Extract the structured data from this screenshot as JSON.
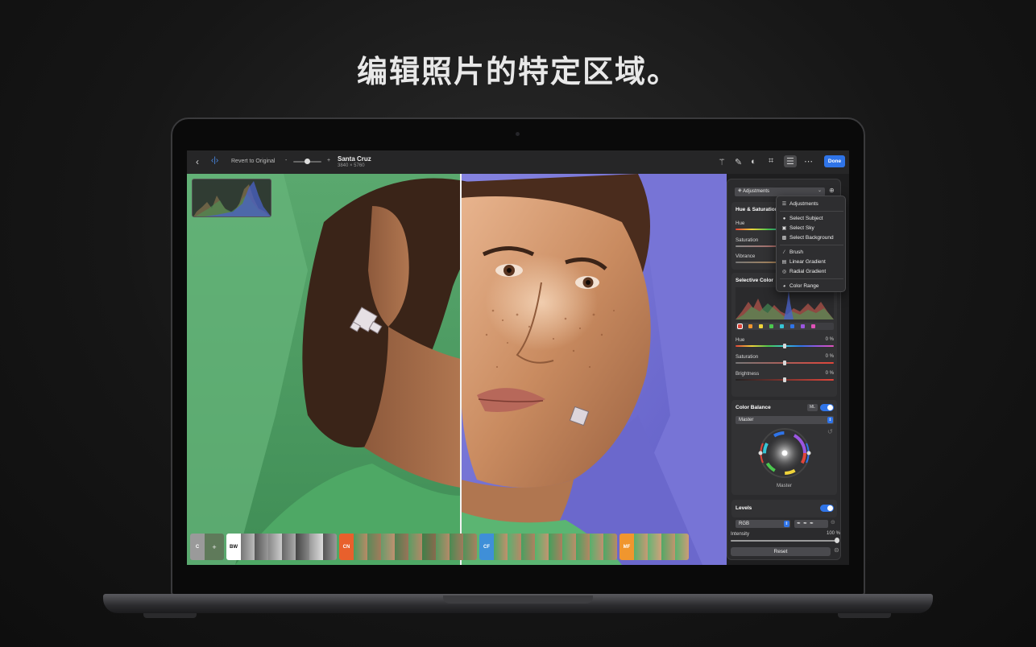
{
  "headline": "编辑照片的特定区域。",
  "toolbar": {
    "back_icon": "chevron-left-icon",
    "compare_icon": "compare-split-icon",
    "revert_label": "Revert to Original",
    "zoom_minus": "-",
    "zoom_plus": "+",
    "doc_title": "Santa Cruz",
    "doc_size": "3840 × 5760",
    "tools": [
      "magic-wand-icon",
      "eraser-icon",
      "mask-icon",
      "crop-icon",
      "adjustments-icon",
      "more-icon"
    ],
    "done_label": "Done"
  },
  "panel": {
    "adjustments_select": "Adjustments",
    "hue_saturation": {
      "title": "Hue & Saturation",
      "hue_label": "Hue",
      "saturation_label": "Saturation",
      "vibrance_label": "Vibrance"
    },
    "selective_color": {
      "title": "Selective Color",
      "swatches": [
        "#e0453a",
        "#f0962e",
        "#f0d43a",
        "#4bc74e",
        "#36c5d6",
        "#2f74e8",
        "#9b56e0",
        "#e052b8"
      ],
      "hue_label": "Hue",
      "hue_value": "0 %",
      "saturation_label": "Saturation",
      "saturation_value": "0 %",
      "brightness_label": "Brightness",
      "brightness_value": "0 %"
    },
    "color_balance": {
      "title": "Color Balance",
      "ml_badge": "ML",
      "mode": "Master",
      "wheel_label": "Master"
    },
    "levels": {
      "title": "Levels",
      "channel": "RGB",
      "intensity_label": "Intensity",
      "intensity_value": "100 %",
      "intensity_fraction": 1.0,
      "reset_label": "Reset"
    }
  },
  "menu": {
    "items": [
      {
        "label": "Adjustments",
        "icon": "sliders-icon"
      },
      {
        "label": "Select Subject",
        "icon": "person-icon"
      },
      {
        "label": "Select Sky",
        "icon": "sky-icon"
      },
      {
        "label": "Select Background",
        "icon": "background-icon"
      },
      {
        "label": "Brush",
        "icon": "brush-icon"
      },
      {
        "label": "Linear Gradient",
        "icon": "linear-gradient-icon"
      },
      {
        "label": "Radial Gradient",
        "icon": "radial-gradient-icon"
      },
      {
        "label": "Color Range",
        "icon": "color-range-icon"
      }
    ]
  },
  "presets": [
    {
      "tag": "C",
      "color": "#9a9a9a"
    },
    {
      "tag": "BW",
      "color": "#ffffff"
    },
    {
      "tag": "CN",
      "color": "#e8602c"
    },
    {
      "tag": "CF",
      "color": "#3f8fd8"
    },
    {
      "tag": "MF",
      "color": "#f0962e"
    }
  ]
}
